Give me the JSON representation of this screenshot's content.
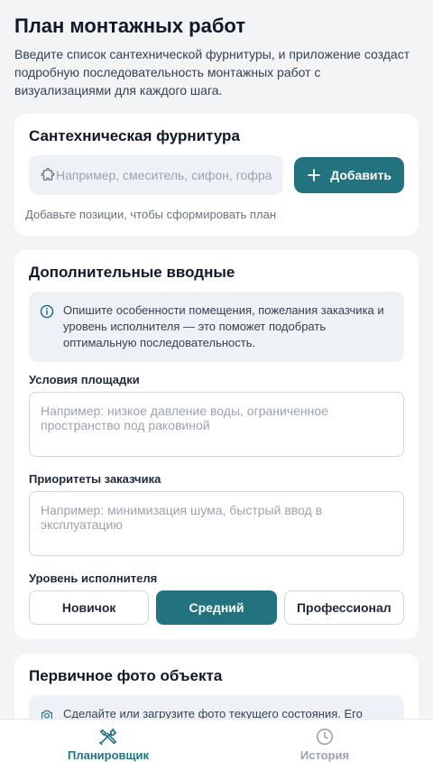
{
  "header": {
    "title": "План монтажных работ",
    "subtitle": "Введите список сантехнической фурнитуры, и приложение создаст подробную последовательность монтажных работ с визуализациями для каждого шага."
  },
  "fittings": {
    "title": "Сантехническая фурнитура",
    "input_placeholder": "Например, смеситель, сифон, гофра",
    "add_label": "Добавить",
    "empty_hint": "Добавьте позиции, чтобы сформировать план"
  },
  "inputs": {
    "title": "Дополнительные вводные",
    "info": "Опишите особенности помещения, пожелания заказчика и уровень исполнителя — это поможет подобрать оптимальную последовательность.",
    "site_label": "Условия площадки",
    "site_placeholder": "Например: низкое давление воды, ограниченное пространство под раковиной",
    "priorities_label": "Приоритеты заказчика",
    "priorities_placeholder": "Например: минимизация шума, быстрый ввод в эксплуатацию",
    "level_label": "Уровень исполнителя",
    "levels": [
      "Новичок",
      "Средний",
      "Профессионал"
    ],
    "selected_level": "Средний"
  },
  "photo": {
    "title": "Первичное фото объекта",
    "info": "Сделайте или загрузите фото текущего состояния. Его"
  },
  "nav": {
    "planner": "Планировщик",
    "history": "История"
  },
  "colors": {
    "accent": "#22737f",
    "background": "#f3f4f6"
  }
}
